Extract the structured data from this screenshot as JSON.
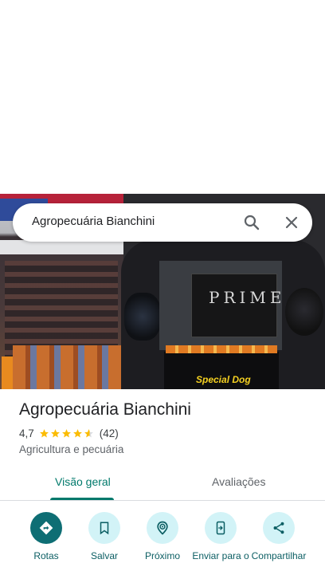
{
  "search": {
    "query": "Agropecuária Bianchini"
  },
  "photo": {
    "board_text": "PRIME",
    "table_brand": "Special Dog"
  },
  "place": {
    "title": "Agropecuária Bianchini",
    "rating": "4,7",
    "rating_stars": 4.7,
    "review_count": "(42)",
    "category": "Agricultura e pecuária"
  },
  "tabs": [
    {
      "label": "Visão geral",
      "selected": true
    },
    {
      "label": "Avaliações",
      "selected": false
    }
  ],
  "actions": [
    {
      "label": "Rotas",
      "icon": "directions-icon"
    },
    {
      "label": "Salvar",
      "icon": "bookmark-icon"
    },
    {
      "label": "Próximo",
      "icon": "nearby-icon"
    },
    {
      "label": "Enviar para o",
      "icon": "send-to-phone-icon"
    },
    {
      "label": "Compartilhar",
      "icon": "share-icon"
    }
  ],
  "colors": {
    "accent": "#00796b",
    "action_primary": "#0e6e74",
    "action_bg": "#d2f3f7",
    "star": "#fbbc04"
  }
}
